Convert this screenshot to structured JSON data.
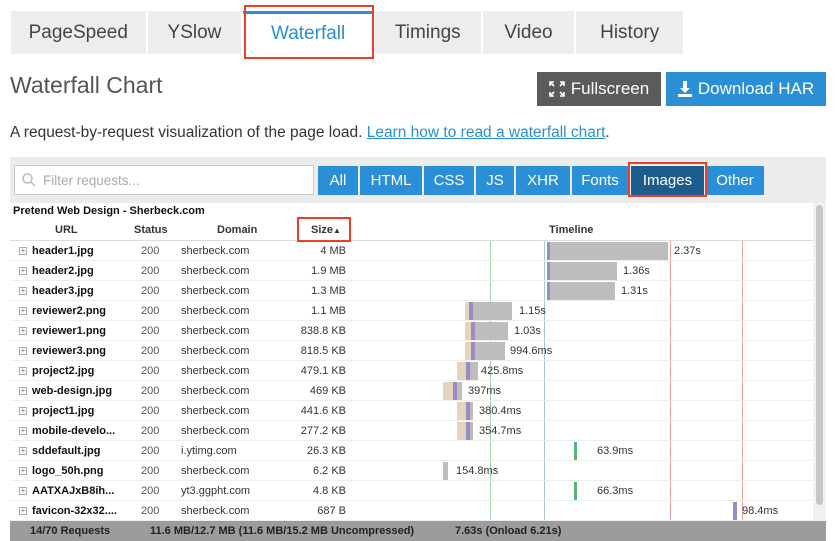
{
  "tabs": [
    {
      "label": "PageSpeed",
      "active": false
    },
    {
      "label": "YSlow",
      "active": false
    },
    {
      "label": "Waterfall",
      "active": true
    },
    {
      "label": "Timings",
      "active": false
    },
    {
      "label": "Video",
      "active": false
    },
    {
      "label": "History",
      "active": false
    }
  ],
  "header": {
    "title": "Waterfall Chart",
    "fullscreen_label": "Fullscreen",
    "download_label": "Download HAR"
  },
  "description": {
    "text": "A request-by-request visualization of the page load. ",
    "link": "Learn how to read a waterfall chart",
    "end": "."
  },
  "filter": {
    "placeholder": "Filter requests...",
    "types": [
      "All",
      "HTML",
      "CSS",
      "JS",
      "XHR",
      "Fonts",
      "Images",
      "Other"
    ],
    "active_type": "Images"
  },
  "table": {
    "site_title": "Pretend Web Design - Sherbeck.com",
    "columns": {
      "url": "URL",
      "status": "Status",
      "domain": "Domain",
      "size": "Size",
      "timeline": "Timeline"
    },
    "sort_indicator": "▲",
    "rows": [
      {
        "url": "header1.jpg",
        "status": "200",
        "domain": "sherbeck.com",
        "size": "4 MB",
        "time": "2.37s"
      },
      {
        "url": "header2.jpg",
        "status": "200",
        "domain": "sherbeck.com",
        "size": "1.9 MB",
        "time": "1.36s"
      },
      {
        "url": "header3.jpg",
        "status": "200",
        "domain": "sherbeck.com",
        "size": "1.3 MB",
        "time": "1.31s"
      },
      {
        "url": "reviewer2.png",
        "status": "200",
        "domain": "sherbeck.com",
        "size": "1.1 MB",
        "time": "1.15s"
      },
      {
        "url": "reviewer1.png",
        "status": "200",
        "domain": "sherbeck.com",
        "size": "838.8 KB",
        "time": "1.03s"
      },
      {
        "url": "reviewer3.png",
        "status": "200",
        "domain": "sherbeck.com",
        "size": "818.5 KB",
        "time": "994.6ms"
      },
      {
        "url": "project2.jpg",
        "status": "200",
        "domain": "sherbeck.com",
        "size": "479.1 KB",
        "time": "425.8ms"
      },
      {
        "url": "web-design.jpg",
        "status": "200",
        "domain": "sherbeck.com",
        "size": "469 KB",
        "time": "397ms"
      },
      {
        "url": "project1.jpg",
        "status": "200",
        "domain": "sherbeck.com",
        "size": "441.6 KB",
        "time": "380.4ms"
      },
      {
        "url": "mobile-develo...",
        "status": "200",
        "domain": "sherbeck.com",
        "size": "277.2 KB",
        "time": "354.7ms"
      },
      {
        "url": "sddefault.jpg",
        "status": "200",
        "domain": "i.ytimg.com",
        "size": "26.3 KB",
        "time": "63.9ms"
      },
      {
        "url": "logo_50h.png",
        "status": "200",
        "domain": "sherbeck.com",
        "size": "6.2 KB",
        "time": "154.8ms"
      },
      {
        "url": "AATXAJxB8ih...",
        "status": "200",
        "domain": "yt3.ggpht.com",
        "size": "4.8 KB",
        "time": "66.3ms"
      },
      {
        "url": "favicon-32x32....",
        "status": "200",
        "domain": "sherbeck.com",
        "size": "687 B",
        "time": "98.4ms"
      }
    ]
  },
  "footer": {
    "requests": "14/70 Requests",
    "size": "11.6 MB/12.7 MB  (11.6 MB/15.2 MB Uncompressed)",
    "time": "7.63s  (Onload 6.21s)"
  },
  "colors": {
    "accent": "#2a8fd6",
    "active_filter": "#1f5c8e",
    "highlight_outline": "#e8402a",
    "bar_receive": "#bdbdbd",
    "bar_wait": "#e5d5bf",
    "bar_connect": "#9b8bc4"
  }
}
